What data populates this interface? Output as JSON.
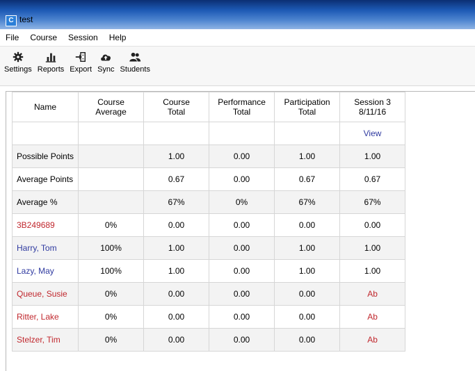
{
  "window": {
    "title": "test"
  },
  "menu": [
    "File",
    "Course",
    "Session",
    "Help"
  ],
  "toolbar": [
    {
      "label": "Settings",
      "icon": "gear-icon"
    },
    {
      "label": "Reports",
      "icon": "bar-chart-icon"
    },
    {
      "label": "Export",
      "icon": "export-icon"
    },
    {
      "label": "Sync",
      "icon": "cloud-upload-icon"
    },
    {
      "label": "Students",
      "icon": "users-icon"
    }
  ],
  "grid": {
    "headers": [
      {
        "line1": "Name",
        "line2": ""
      },
      {
        "line1": "Course",
        "line2": "Average"
      },
      {
        "line1": "Course",
        "line2": "Total"
      },
      {
        "line1": "Performance",
        "line2": "Total"
      },
      {
        "line1": "Participation",
        "line2": "Total"
      },
      {
        "line1": "Session 3",
        "line2": "8/11/16"
      }
    ],
    "view_link": "View",
    "rows": [
      {
        "name": "Possible Points",
        "type": "summary",
        "cells": [
          "",
          "1.00",
          "0.00",
          "1.00",
          "1.00"
        ]
      },
      {
        "name": "Average Points",
        "type": "summary",
        "cells": [
          "",
          "0.67",
          "0.00",
          "0.67",
          "0.67"
        ]
      },
      {
        "name": "Average %",
        "type": "summary",
        "cells": [
          "",
          "67%",
          "0%",
          "67%",
          "67%"
        ]
      },
      {
        "name": "3B249689",
        "type": "red",
        "cells": [
          "0%",
          "0.00",
          "0.00",
          "0.00",
          "0.00"
        ]
      },
      {
        "name": "Harry, Tom",
        "type": "blue",
        "cells": [
          "100%",
          "1.00",
          "0.00",
          "1.00",
          "1.00"
        ]
      },
      {
        "name": "Lazy, May",
        "type": "blue",
        "cells": [
          "100%",
          "1.00",
          "0.00",
          "1.00",
          "1.00"
        ]
      },
      {
        "name": "Queue, Susie",
        "type": "red",
        "cells": [
          "0%",
          "0.00",
          "0.00",
          "0.00",
          "Ab"
        ]
      },
      {
        "name": "Ritter, Lake",
        "type": "red",
        "cells": [
          "0%",
          "0.00",
          "0.00",
          "0.00",
          "Ab"
        ]
      },
      {
        "name": "Stelzer, Tim",
        "type": "red",
        "cells": [
          "0%",
          "0.00",
          "0.00",
          "0.00",
          "Ab"
        ]
      }
    ]
  },
  "colors": {
    "absent_red": "#c0272d",
    "student_blue": "#2f3aa0"
  }
}
